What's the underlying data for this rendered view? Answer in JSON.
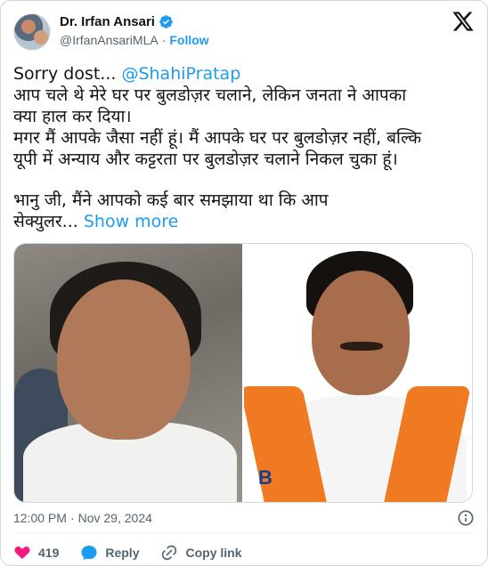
{
  "author": {
    "display_name": "Dr. Irfan Ansari",
    "handle": "@IrfanAnsariMLA",
    "separator": "·",
    "follow_label": "Follow"
  },
  "tweet": {
    "line1_prefix": "Sorry dost... ",
    "line1_mention": "@ShahiPratap",
    "line2": "आप चले थे मेरे घर पर बुलडोज़र चलाने, लेकिन जनता ने आपका",
    "line3": "क्या हाल कर दिया।",
    "line4": "मगर मैं आपके जैसा नहीं हूं। मैं आपके घर पर बुलडोज़र नहीं, बल्कि",
    "line5": "यूपी में अन्याय और कट्टरता पर बुलडोज़र चलाने निकल चुका हूं।",
    "line6": "भानु जी, मैंने आपको कई बार समझाया था कि आप",
    "line7_prefix": "सेक्युलर... ",
    "show_more_label": "Show more"
  },
  "media": {
    "right_photo_letter": "B"
  },
  "meta": {
    "time": "12:00 PM",
    "separator": "·",
    "date": "Nov 29, 2024"
  },
  "actions": {
    "like_count": "419",
    "reply_label": "Reply",
    "copy_link_label": "Copy link"
  },
  "colors": {
    "accent": "#1d9bf0",
    "like": "#f91880",
    "text": "#0f1419",
    "secondary": "#536471"
  },
  "icons": {
    "verified": "verified-badge-icon",
    "x_logo": "x-logo-icon",
    "info": "info-icon",
    "heart": "heart-icon",
    "reply": "reply-bubble-icon",
    "link": "link-icon"
  }
}
